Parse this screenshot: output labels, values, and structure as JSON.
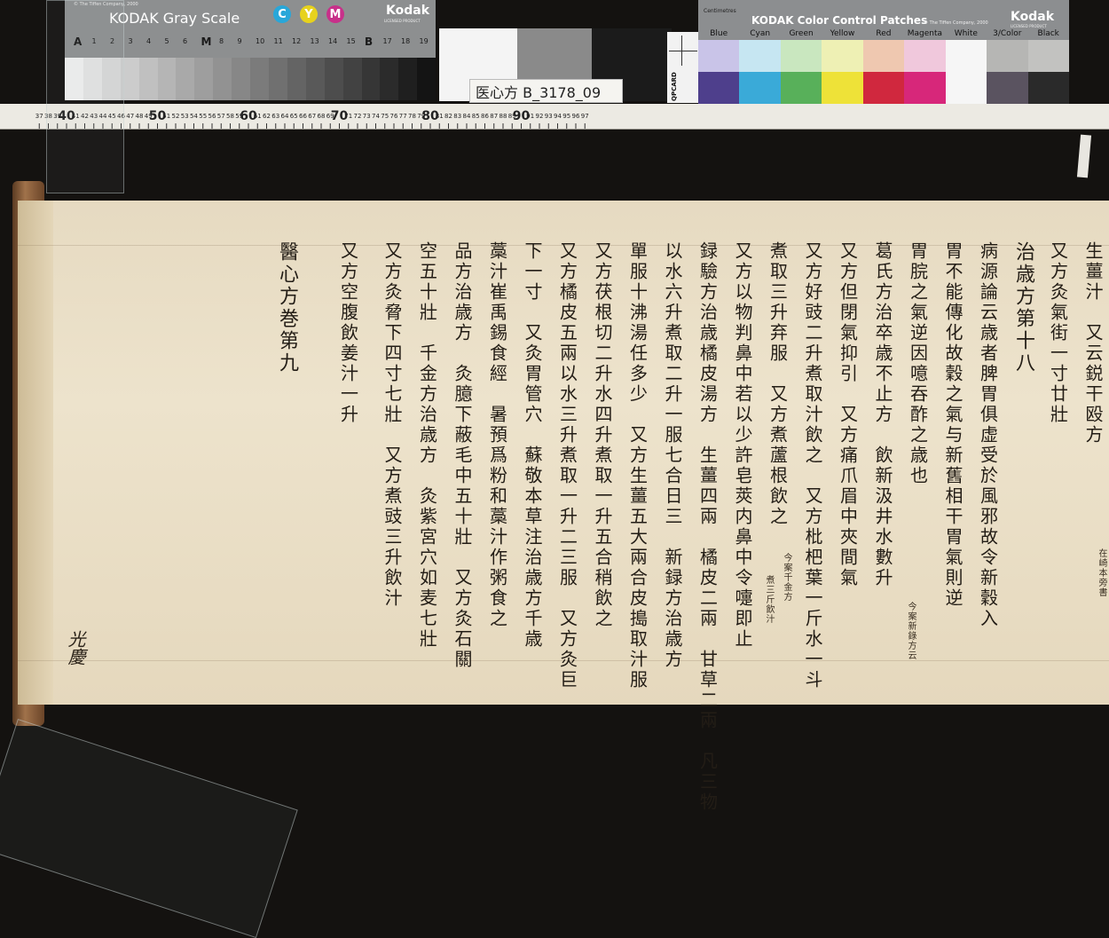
{
  "gray_scale": {
    "copyright": "© The Tiffen Company, 2000",
    "title": "KODAK Gray Scale",
    "cmy": [
      "C",
      "Y",
      "M"
    ],
    "brand": "Kodak",
    "brand_sub": "LICENSED PRODUCT",
    "labels": [
      "A",
      "1",
      "2",
      "3",
      "4",
      "5",
      "6",
      "M",
      "8",
      "9",
      "10",
      "11",
      "12",
      "13",
      "14",
      "15",
      "B",
      "17",
      "18",
      "19"
    ]
  },
  "id_label": "医心方 B_3178_09",
  "qp_card": "QPCARD",
  "color_card": {
    "ruler_label": "Centimetres",
    "title": "KODAK Color Control Patches",
    "copyright": "© The Tiffen Company, 2000",
    "brand": "Kodak",
    "brand_sub": "LICENSED PRODUCT",
    "patch_names": [
      "Blue",
      "Cyan",
      "Green",
      "Yellow",
      "Red",
      "Magenta",
      "White",
      "3/Color",
      "Black"
    ],
    "top_colors": [
      "#c9c4e8",
      "#c6e6f2",
      "#c9e7bf",
      "#eef0b4",
      "#efc8b0",
      "#f0c8dc",
      "#f6f6f6",
      "#b6b6b4",
      "#c2c2c0"
    ],
    "bottom_colors": [
      "#4e3f8c",
      "#3aaad8",
      "#58b05a",
      "#eee238",
      "#d0283e",
      "#d7277a",
      "#f6f6f6",
      "#5a5360",
      "#2a2a2a"
    ]
  },
  "ruler": {
    "major_labels": [
      "40",
      "50",
      "60",
      "70",
      "80",
      "90"
    ]
  },
  "manuscript": {
    "columns": [
      "生薑汁　又云鋭干殴方",
      "又方灸氣街一寸廿壯",
      "治歳方第十八",
      "病源論云歳者脾胃俱虚受於風邪故令新穀入",
      "胃不能傳化故穀之氣与新舊相干胃氣則逆",
      "胃脘之氣逆因噫吞酢之歳也",
      "葛氏方治卒歳不止方　飲新汲井水數升",
      "又方但閉氣抑引　又方痛爪眉中夾間氣",
      "又方好豉二升煮取汁飲之　又方枇杷葉一斤水一斗",
      "煮取三升弃服　又方煮蘆根飲之",
      "又方以物判鼻中若以少許皂莢内鼻中令嚏即止",
      "録驗方治歳橘皮湯方　生薑四兩　橘皮二兩　甘草二兩　凡三物",
      "以水六升煮取二升一服七合日三　新録方治歳方",
      "單服十沸湯任多少　又方生薑五大兩合皮搗取汁服",
      "又方茯根切二升水四升煮取一升五合稍飲之",
      "又方橘皮五兩以水三升煮取一升二三服　又方灸巨",
      "下一寸　又灸胃管穴　蘇敬本草注治歳方千歳",
      "藁汁崔禹錫食經　暑預爲粉和藁汁作粥食之",
      "品方治歳方　灸臆下蔽毛中五十壯　又方灸石關",
      "空五十壯　千金方治歳方　灸紫宮穴如麦七壯",
      "又方灸脅下四寸七壯　又方煮豉三升飲汁",
      "又方空腹飲姜汁一升",
      "醫心方巻第九"
    ],
    "notes": [
      "今案新錄方云",
      "今案千金方",
      "煮三斤飲汁",
      "在崎本旁書"
    ],
    "seal": "光慶"
  }
}
